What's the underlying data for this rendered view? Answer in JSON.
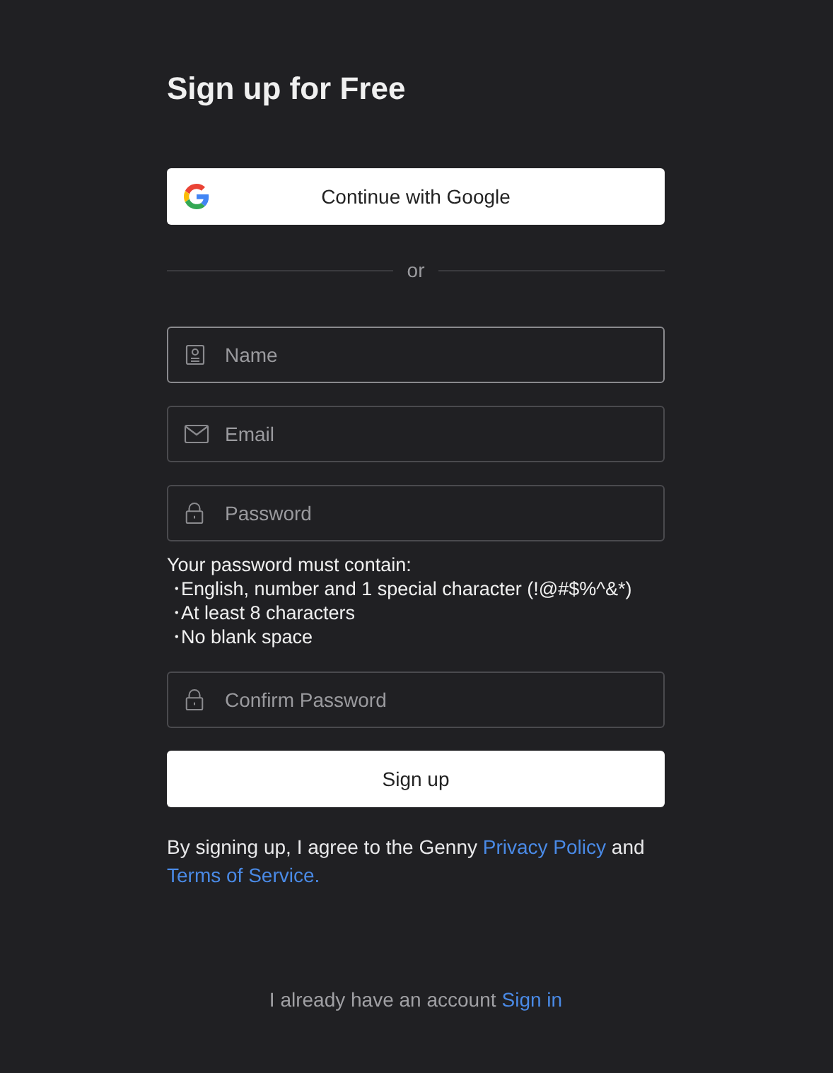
{
  "title": "Sign up for Free",
  "google_button": {
    "label": "Continue with Google"
  },
  "divider": {
    "label": "or"
  },
  "fields": [
    {
      "kind": "name",
      "placeholder": "Name",
      "focused": true
    },
    {
      "kind": "email",
      "placeholder": "Email",
      "focused": false
    },
    {
      "kind": "password",
      "placeholder": "Password",
      "focused": false
    }
  ],
  "password_rules": {
    "heading": "Your password must contain:",
    "items": [
      {
        "bullet": "・",
        "text": "English, number and 1 special character (!@#$%^&*)"
      },
      {
        "bullet": "・",
        "text": "At least 8 characters"
      },
      {
        "bullet": "・",
        "text": "No blank space"
      }
    ]
  },
  "confirm_field": {
    "kind": "password",
    "placeholder": "Confirm Password",
    "focused": false
  },
  "submit_button": {
    "label": "Sign up"
  },
  "legal": {
    "before": "By signing up, I agree to the Genny",
    "privacy_link": "Privacy Policy",
    "middle": "and",
    "terms_link": "Terms of Service."
  },
  "footer": {
    "text": "I already have an account",
    "link": "Sign in"
  }
}
